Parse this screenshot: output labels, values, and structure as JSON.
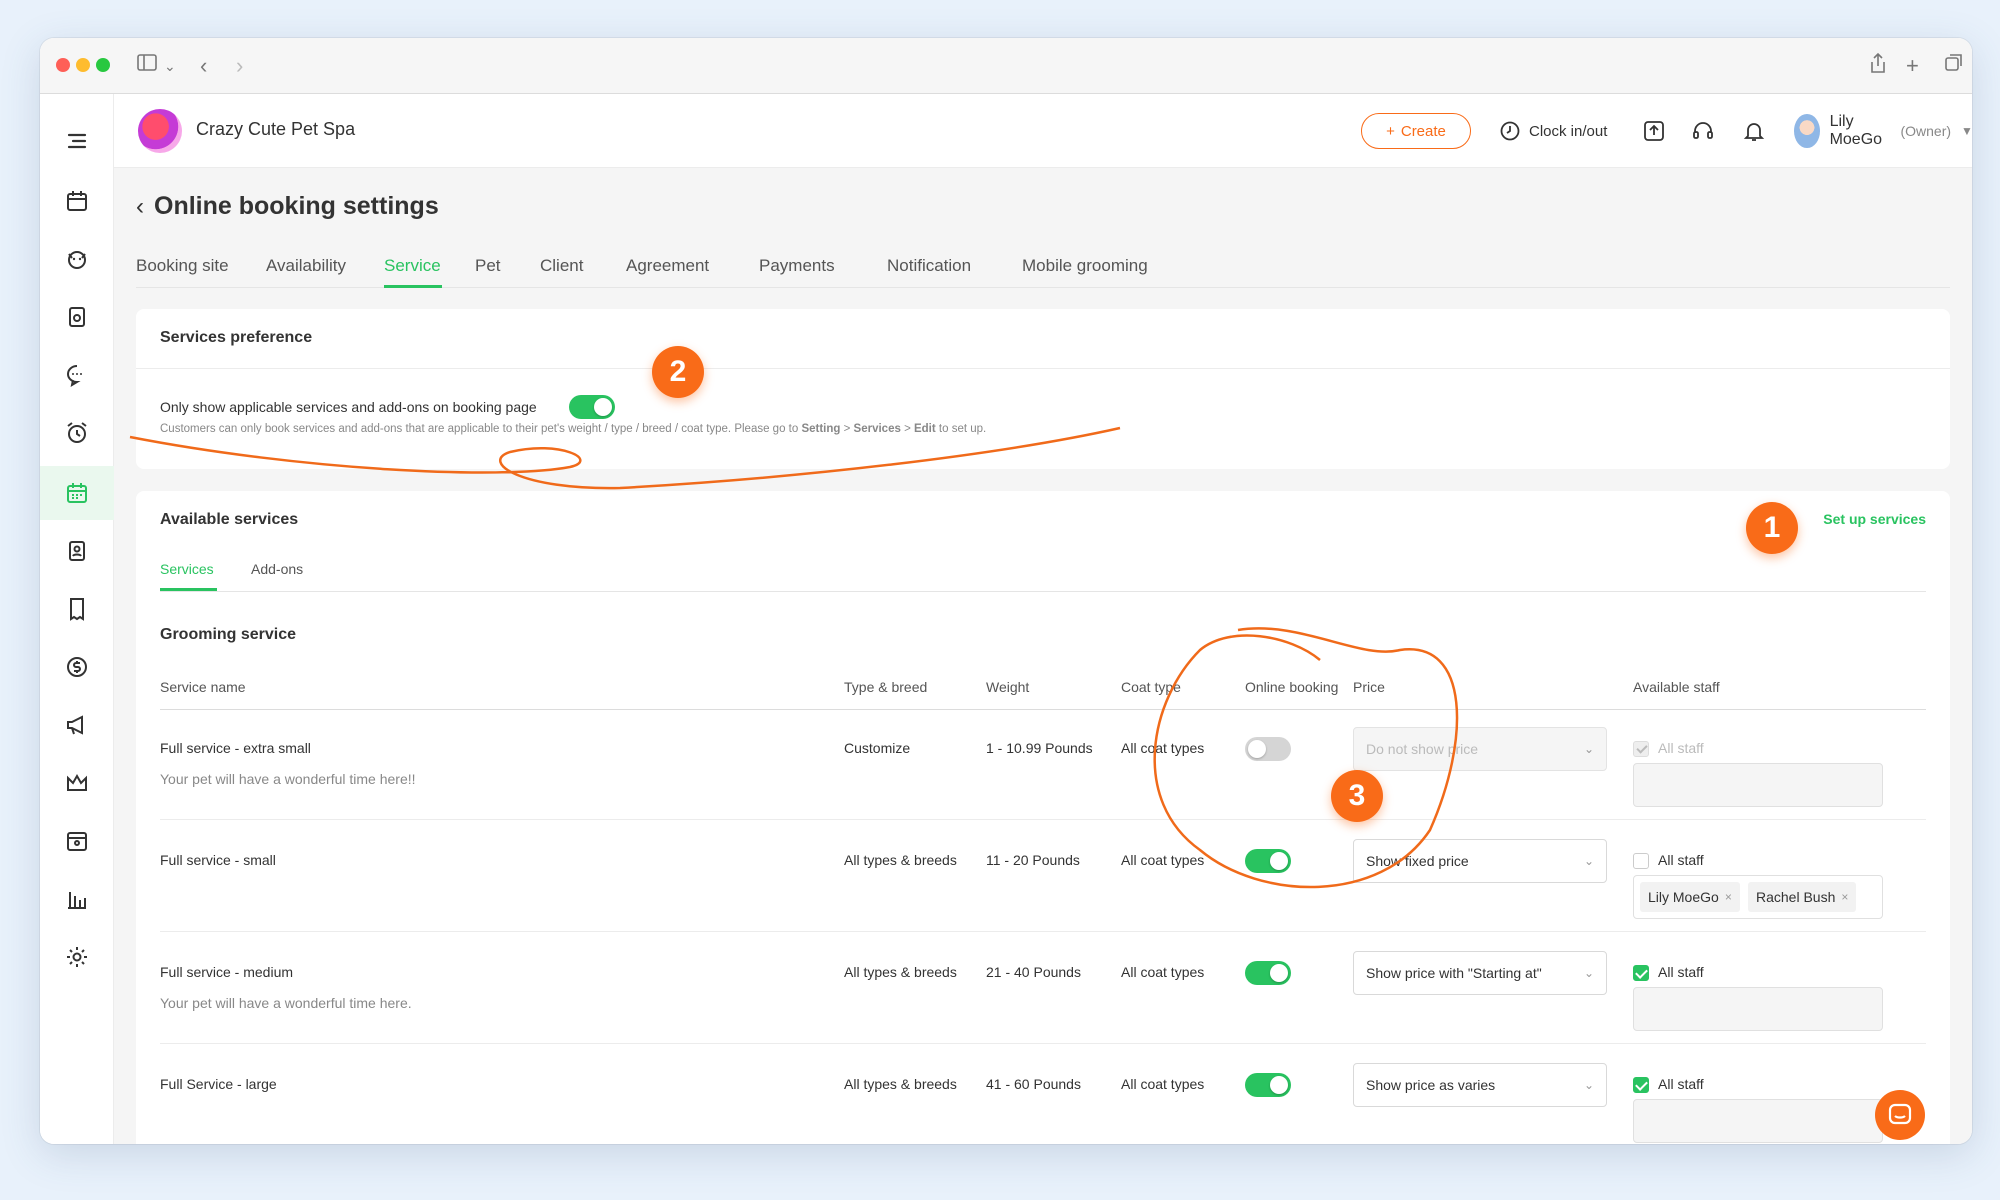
{
  "business": {
    "name": "Crazy Cute Pet Spa"
  },
  "header": {
    "create_label": "Create",
    "clock_label": "Clock in/out",
    "user_name": "Lily MoeGo",
    "user_role": "(Owner)"
  },
  "page": {
    "title": "Online booking settings"
  },
  "tabs": [
    "Booking site",
    "Availability",
    "Service",
    "Pet",
    "Client",
    "Agreement",
    "Payments",
    "Notification",
    "Mobile grooming"
  ],
  "active_tab": "Service",
  "preference": {
    "title": "Services preference",
    "toggle_label": "Only show applicable services and add-ons on booking page",
    "toggle_on": true,
    "help_text_prefix": "Customers can only book services and add-ons that are applicable to their pet's weight / type / breed / coat type. Please go to ",
    "help_path_1": "Setting",
    "help_sep_1": " > ",
    "help_path_2": "Services",
    "help_sep_2": " > ",
    "help_path_3": "Edit",
    "help_suffix": " to set up."
  },
  "available": {
    "title": "Available services",
    "setup_link": "Set up services",
    "subtabs": [
      "Services",
      "Add-ons"
    ],
    "section_title": "Grooming service",
    "columns": [
      "Service name",
      "Type & breed",
      "Weight",
      "Coat type",
      "Online booking",
      "Price",
      "Available staff"
    ],
    "rows": [
      {
        "name": "Full service - extra small",
        "desc": "Your pet will have a wonderful time here!!",
        "type": "Customize",
        "weight": "1 - 10.99 Pounds",
        "coat": "All coat types",
        "online": false,
        "price": "Do not show price",
        "staff_label": "All staff",
        "staff_all": true,
        "staff_tags": []
      },
      {
        "name": "Full service - small",
        "desc": "",
        "type": "All types & breeds",
        "weight": "11 - 20 Pounds",
        "coat": "All coat types",
        "online": true,
        "price": "Show fixed price",
        "staff_label": "All staff",
        "staff_all": false,
        "staff_tags": [
          "Lily MoeGo",
          "Rachel Bush"
        ]
      },
      {
        "name": "Full service - medium",
        "desc": "Your pet will have a wonderful time here.",
        "type": "All types & breeds",
        "weight": "21 - 40 Pounds",
        "coat": "All coat types",
        "online": true,
        "price": "Show price with \"Starting at\"",
        "staff_label": "All staff",
        "staff_all": true,
        "staff_tags": []
      },
      {
        "name": "Full Service - large",
        "desc": "",
        "type": "All types & breeds",
        "weight": "41 - 60 Pounds",
        "coat": "All coat types",
        "online": true,
        "price": "Show price as varies",
        "staff_label": "All staff",
        "staff_all": true,
        "staff_tags": []
      }
    ]
  },
  "annotations": [
    "1",
    "2",
    "3"
  ],
  "colors": {
    "accent": "#29c360",
    "brand": "#f96b18"
  },
  "icons": [
    "menu-icon",
    "calendar-icon",
    "pet-icon",
    "store-icon",
    "message-icon",
    "alarm-icon",
    "booking-icon",
    "badge-icon",
    "receipt-icon",
    "dollar-icon",
    "megaphone-icon",
    "crown-icon",
    "retail-icon",
    "report-icon",
    "settings-icon"
  ]
}
